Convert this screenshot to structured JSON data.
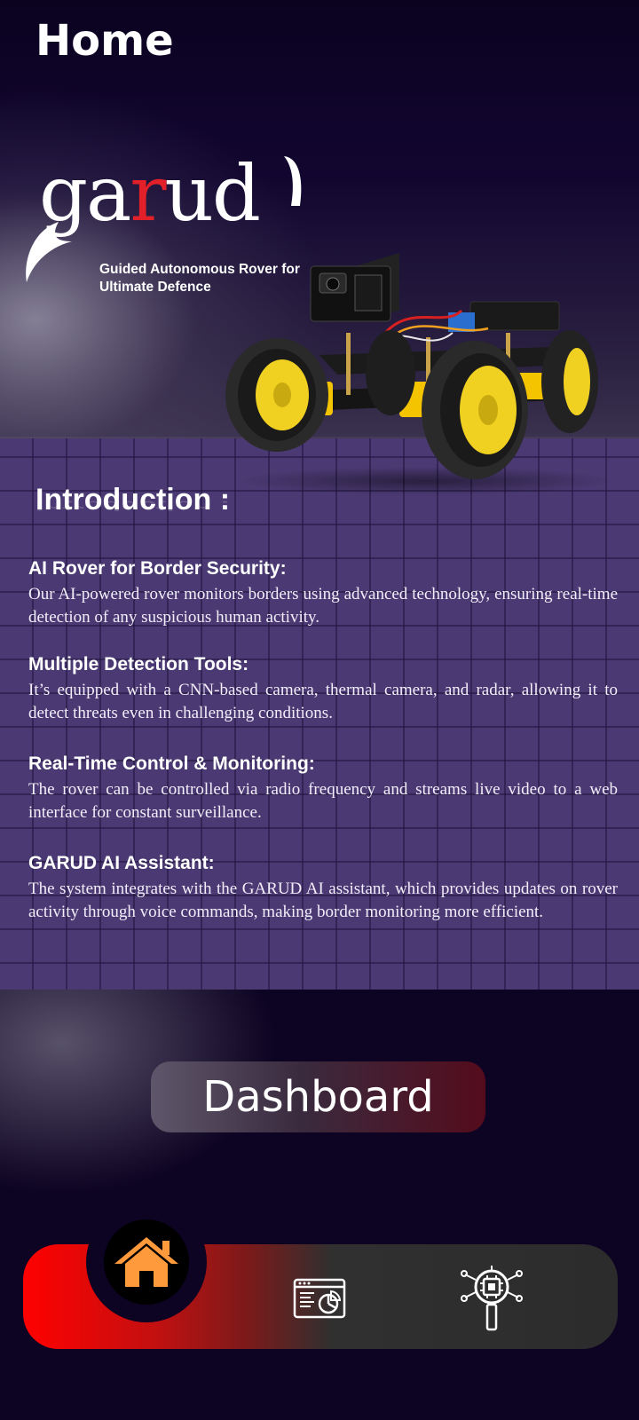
{
  "header": {
    "title": "Home"
  },
  "logo": {
    "word_pre": "ga",
    "word_red": "r",
    "word_post": "ud",
    "tagline_line1": "Guided Autonomous Rover for",
    "tagline_line2": "Ultimate Defence"
  },
  "intro": {
    "heading": "Introduction :",
    "items": [
      {
        "title": "AI Rover for Border Security:",
        "text": "Our AI-powered rover monitors borders using advanced technology, ensuring real-time detection of any suspicious human activity."
      },
      {
        "title": "Multiple Detection Tools:",
        "text": "It’s equipped with a CNN-based camera, thermal camera, and radar, allowing it to detect threats even in challenging conditions."
      },
      {
        "title": "Real-Time Control & Monitoring:",
        "text": "The rover can be controlled via radio frequency and streams live video to a web interface for constant surveillance."
      },
      {
        "title": "GARUD AI Assistant:",
        "text": "The system integrates with the GARUD AI assistant, which provides updates on rover activity through voice commands, making border monitoring more efficient."
      }
    ]
  },
  "dashboard_button": {
    "label": "Dashboard"
  },
  "bottom_nav": {
    "items": [
      {
        "icon": "home-icon",
        "active": true
      },
      {
        "icon": "dashboard-chart-icon",
        "active": false
      },
      {
        "icon": "ai-chip-search-icon",
        "active": false
      }
    ],
    "active_color": "#ff9a3c",
    "gradient_start": "#ff0000",
    "gradient_end": "#2c2c2c"
  },
  "colors": {
    "background": "#0c0420",
    "intro_panel": "#4a3972",
    "logo_accent": "#e2202a"
  }
}
